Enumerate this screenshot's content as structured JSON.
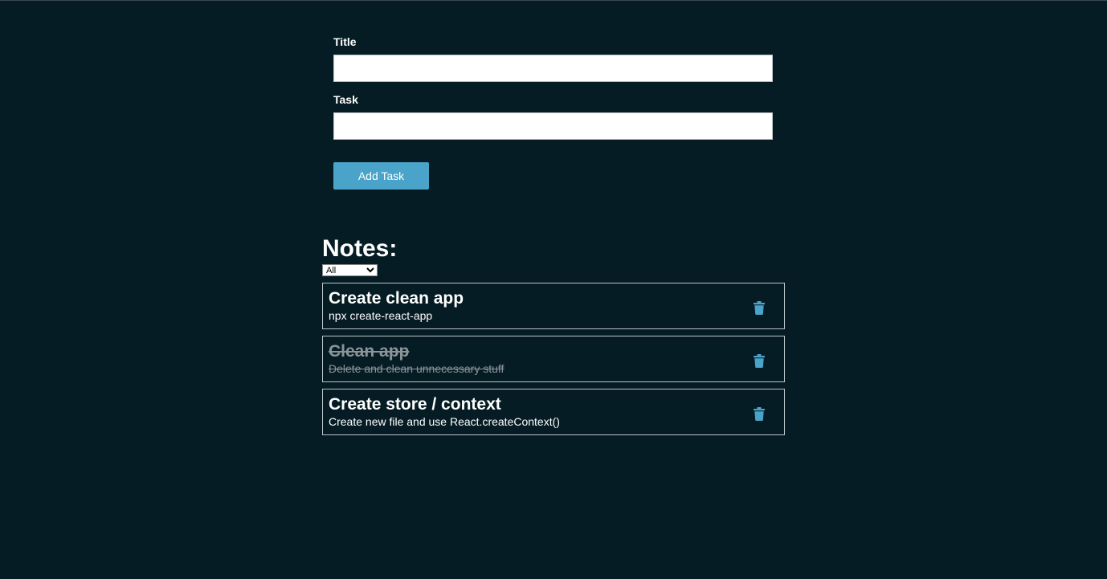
{
  "form": {
    "title_label": "Title",
    "title_value": "",
    "task_label": "Task",
    "task_value": "",
    "add_button_label": "Add Task"
  },
  "notes": {
    "heading": "Notes:",
    "filter": {
      "selected": "All"
    },
    "items": [
      {
        "title": "Create clean app",
        "text": "npx create-react-app",
        "done": false
      },
      {
        "title": "Clean app",
        "text": "Delete and clean unnecessary stuff",
        "done": true
      },
      {
        "title": "Create store / context",
        "text": "Create new file and use React.createContext()",
        "done": false
      }
    ]
  },
  "icons": {
    "delete": "trash-icon"
  },
  "colors": {
    "background": "#061c24",
    "accent": "#4aa3c8",
    "done_text": "#8a9599"
  }
}
